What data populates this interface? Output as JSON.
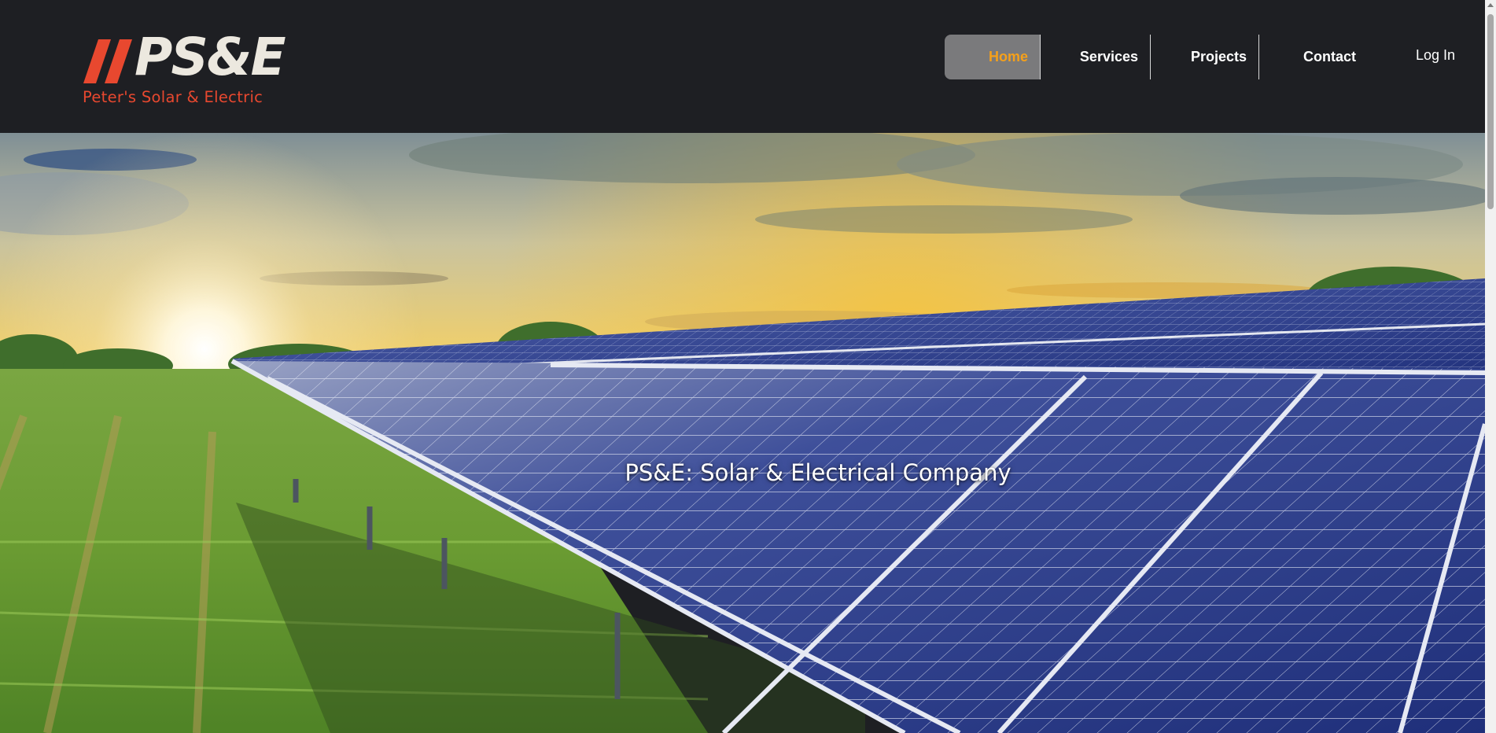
{
  "site": {
    "logo_mark": "PS&E",
    "logo_tagline": "Peter's Solar & Electric"
  },
  "nav": {
    "items": [
      {
        "label": "Home",
        "active": true
      },
      {
        "label": "Services",
        "active": false
      },
      {
        "label": "Projects",
        "active": false
      },
      {
        "label": "Contact",
        "active": false
      }
    ],
    "login_label": "Log In"
  },
  "hero": {
    "title": "PS&E: Solar & Electrical Company"
  },
  "colors": {
    "header_bg": "#1e1f23",
    "brand_red": "#e8482f",
    "logo_text": "#ece8df",
    "nav_active_bg": "#7a7a7c",
    "nav_active_text": "#f5a01a"
  },
  "icons": {
    "logo_slashes": "double-slash-logo-icon",
    "scroll_up": "chevron-up-icon"
  }
}
